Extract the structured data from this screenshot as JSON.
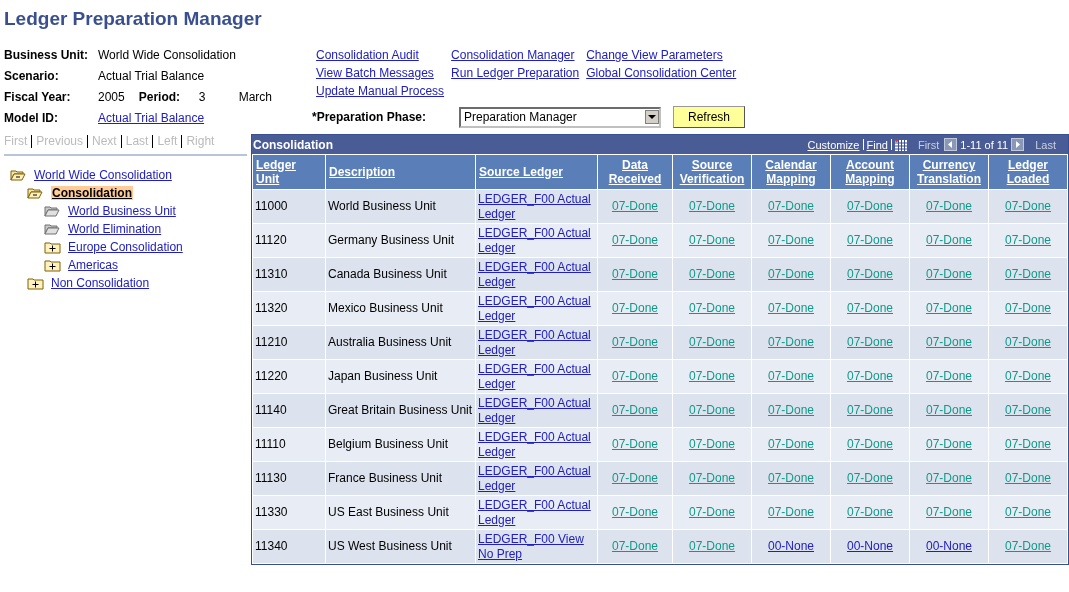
{
  "page_title": "Ledger Preparation Manager",
  "fields": [
    {
      "label": "Business Unit:",
      "value": "World Wide Consolidation"
    },
    {
      "label": "Scenario:",
      "value": "Actual Trial Balance"
    },
    {
      "label": "Fiscal Year:",
      "value": "2005",
      "extra_label": "Period:",
      "extra_value": "3",
      "extra_text": "March"
    },
    {
      "label": "Model ID:",
      "link": "Actual Trial Balance"
    }
  ],
  "links": [
    [
      "Consolidation Audit",
      "View Batch Messages",
      "Update Manual Process"
    ],
    [
      "Consolidation Manager",
      "Run Ledger Preparation"
    ],
    [
      "Change View Parameters",
      "Global Consolidation Center"
    ]
  ],
  "phase": {
    "label": "*Preparation Phase:",
    "value": "Preparation Manager"
  },
  "refresh_button": "Refresh",
  "tree_nav": [
    {
      "label": "First",
      "disabled": true
    },
    {
      "label": "Previous",
      "disabled": true
    },
    {
      "label": "Next",
      "disabled": true
    },
    {
      "label": "Last",
      "disabled": true
    },
    {
      "label": "Left",
      "disabled": true
    },
    {
      "label": "Right",
      "disabled": true
    }
  ],
  "tree": [
    {
      "label": "World Wide Consolidation",
      "kind": "open",
      "selected": false,
      "children": [
        {
          "label": "Consolidation",
          "kind": "open",
          "selected": true,
          "children": [
            {
              "label": "World Business Unit",
              "kind": "leaf",
              "selected": false
            },
            {
              "label": "World Elimination",
              "kind": "leaf",
              "selected": false
            },
            {
              "label": "Europe Consolidation",
              "kind": "closed",
              "selected": false
            },
            {
              "label": "Americas",
              "kind": "closed",
              "selected": false
            }
          ]
        },
        {
          "label": "Non Consolidation",
          "kind": "closed",
          "selected": false
        }
      ]
    }
  ],
  "grid": {
    "title": "Consolidation",
    "tools": [
      "Customize",
      "Find"
    ],
    "pager": {
      "first": "First",
      "range": "1-11 of 11",
      "last": "Last"
    },
    "columns": [
      "Ledger Unit",
      "Description",
      "Source Ledger",
      "Data Received",
      "Source Verification",
      "Calendar Mapping",
      "Account Mapping",
      "Currency Translation",
      "Ledger Loaded"
    ],
    "rows": [
      {
        "unit": "11000",
        "description": "World Business Unit",
        "source": "LEDGER_F00 Actual Ledger",
        "status": [
          {
            "text": "07-Done",
            "kind": "done"
          },
          {
            "text": "07-Done",
            "kind": "done"
          },
          {
            "text": "07-Done",
            "kind": "done"
          },
          {
            "text": "07-Done",
            "kind": "done"
          },
          {
            "text": "07-Done",
            "kind": "done"
          },
          {
            "text": "07-Done",
            "kind": "done"
          }
        ]
      },
      {
        "unit": "11120",
        "description": "Germany Business Unit",
        "source": "LEDGER_F00 Actual Ledger",
        "status": [
          {
            "text": "07-Done",
            "kind": "done"
          },
          {
            "text": "07-Done",
            "kind": "done"
          },
          {
            "text": "07-Done",
            "kind": "done"
          },
          {
            "text": "07-Done",
            "kind": "done"
          },
          {
            "text": "07-Done",
            "kind": "done"
          },
          {
            "text": "07-Done",
            "kind": "done"
          }
        ]
      },
      {
        "unit": "11310",
        "description": "Canada Business Unit",
        "source": "LEDGER_F00 Actual Ledger",
        "status": [
          {
            "text": "07-Done",
            "kind": "done"
          },
          {
            "text": "07-Done",
            "kind": "done"
          },
          {
            "text": "07-Done",
            "kind": "done"
          },
          {
            "text": "07-Done",
            "kind": "done"
          },
          {
            "text": "07-Done",
            "kind": "done"
          },
          {
            "text": "07-Done",
            "kind": "done"
          }
        ]
      },
      {
        "unit": "11320",
        "description": "Mexico Business Unit",
        "source": "LEDGER_F00 Actual Ledger",
        "status": [
          {
            "text": "07-Done",
            "kind": "done"
          },
          {
            "text": "07-Done",
            "kind": "done"
          },
          {
            "text": "07-Done",
            "kind": "done"
          },
          {
            "text": "07-Done",
            "kind": "done"
          },
          {
            "text": "07-Done",
            "kind": "done"
          },
          {
            "text": "07-Done",
            "kind": "done"
          }
        ]
      },
      {
        "unit": "11210",
        "description": "Australia Business Unit",
        "source": "LEDGER_F00 Actual Ledger",
        "status": [
          {
            "text": "07-Done",
            "kind": "done"
          },
          {
            "text": "07-Done",
            "kind": "done"
          },
          {
            "text": "07-Done",
            "kind": "done"
          },
          {
            "text": "07-Done",
            "kind": "done"
          },
          {
            "text": "07-Done",
            "kind": "done"
          },
          {
            "text": "07-Done",
            "kind": "done"
          }
        ]
      },
      {
        "unit": "11220",
        "description": "Japan Business Unit",
        "source": "LEDGER_F00 Actual Ledger",
        "status": [
          {
            "text": "07-Done",
            "kind": "done"
          },
          {
            "text": "07-Done",
            "kind": "done"
          },
          {
            "text": "07-Done",
            "kind": "done"
          },
          {
            "text": "07-Done",
            "kind": "done"
          },
          {
            "text": "07-Done",
            "kind": "done"
          },
          {
            "text": "07-Done",
            "kind": "done"
          }
        ]
      },
      {
        "unit": "11140",
        "description": "Great Britain Business Unit",
        "source": "LEDGER_F00 Actual Ledger",
        "status": [
          {
            "text": "07-Done",
            "kind": "done"
          },
          {
            "text": "07-Done",
            "kind": "done"
          },
          {
            "text": "07-Done",
            "kind": "done"
          },
          {
            "text": "07-Done",
            "kind": "done"
          },
          {
            "text": "07-Done",
            "kind": "done"
          },
          {
            "text": "07-Done",
            "kind": "done"
          }
        ]
      },
      {
        "unit": "11110",
        "description": "Belgium Business Unit",
        "source": "LEDGER_F00 Actual Ledger",
        "status": [
          {
            "text": "07-Done",
            "kind": "done"
          },
          {
            "text": "07-Done",
            "kind": "done"
          },
          {
            "text": "07-Done",
            "kind": "done"
          },
          {
            "text": "07-Done",
            "kind": "done"
          },
          {
            "text": "07-Done",
            "kind": "done"
          },
          {
            "text": "07-Done",
            "kind": "done"
          }
        ]
      },
      {
        "unit": "11130",
        "description": "France Business Unit",
        "source": "LEDGER_F00 Actual Ledger",
        "status": [
          {
            "text": "07-Done",
            "kind": "done"
          },
          {
            "text": "07-Done",
            "kind": "done"
          },
          {
            "text": "07-Done",
            "kind": "done"
          },
          {
            "text": "07-Done",
            "kind": "done"
          },
          {
            "text": "07-Done",
            "kind": "done"
          },
          {
            "text": "07-Done",
            "kind": "done"
          }
        ]
      },
      {
        "unit": "11330",
        "description": "US East Business Unit",
        "source": "LEDGER_F00 Actual Ledger",
        "status": [
          {
            "text": "07-Done",
            "kind": "done"
          },
          {
            "text": "07-Done",
            "kind": "done"
          },
          {
            "text": "07-Done",
            "kind": "done"
          },
          {
            "text": "07-Done",
            "kind": "done"
          },
          {
            "text": "07-Done",
            "kind": "done"
          },
          {
            "text": "07-Done",
            "kind": "done"
          }
        ]
      },
      {
        "unit": "11340",
        "description": "US West Business Unit",
        "source": "LEDGER_F00 View No Prep",
        "status": [
          {
            "text": "07-Done",
            "kind": "done"
          },
          {
            "text": "07-Done",
            "kind": "done"
          },
          {
            "text": "00-None",
            "kind": "none"
          },
          {
            "text": "00-None",
            "kind": "none"
          },
          {
            "text": "00-None",
            "kind": "none"
          },
          {
            "text": "07-Done",
            "kind": "done"
          }
        ]
      }
    ]
  }
}
